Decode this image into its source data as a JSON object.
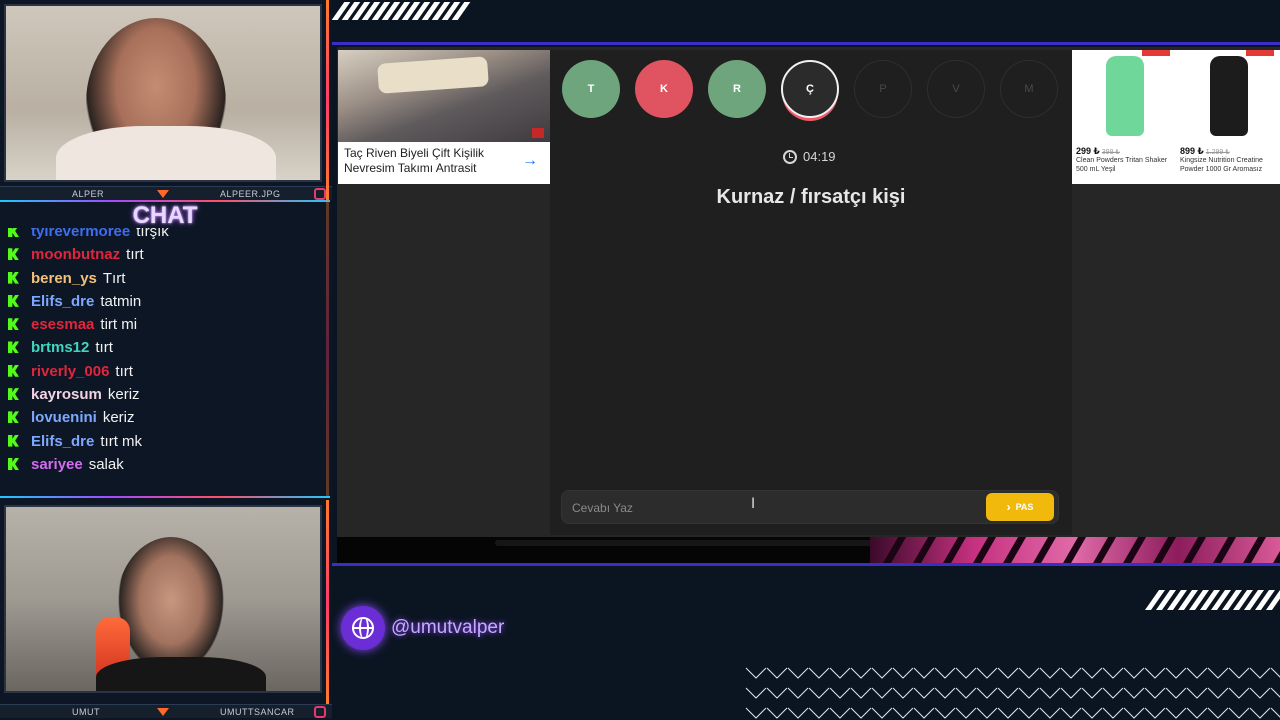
{
  "cams": {
    "top": {
      "left_name": "ALPER",
      "right_name": "ALPEER.JPG"
    },
    "bottom": {
      "left_name": "UMUT",
      "right_name": "UMUTTSANCAR"
    }
  },
  "chat": {
    "title": "CHAT",
    "messages": [
      {
        "user": "tyirevermoree",
        "text": "tırşık",
        "color": "#3f6df0"
      },
      {
        "user": "moonbutnaz",
        "text": "tırt",
        "color": "#e0263c"
      },
      {
        "user": "beren_ys",
        "text": "Tırt",
        "color": "#f2c27a"
      },
      {
        "user": "Elifs_dre",
        "text": "tatmin",
        "color": "#7ea8ff"
      },
      {
        "user": "esesmaa",
        "text": "tirt mi",
        "color": "#e0263c"
      },
      {
        "user": "brtms12",
        "text": "tırt",
        "color": "#3fd6c0"
      },
      {
        "user": "riverly_006",
        "text": "tırt",
        "color": "#e0263c"
      },
      {
        "user": "kayrosum",
        "text": "keriz",
        "color": "#f3d3e3"
      },
      {
        "user": "lovuenini",
        "text": "keriz",
        "color": "#7ea8ff"
      },
      {
        "user": "Elifs_dre",
        "text": "tırt mk",
        "color": "#7ea8ff"
      },
      {
        "user": "sariyee",
        "text": "salak",
        "color": "#d46cf2"
      }
    ]
  },
  "ads": {
    "left": {
      "caption": "Taç Riven Biyeli Çift Kişilik Nevresim Takımı Antrasit",
      "arrow": "→"
    },
    "right": [
      {
        "price": "299 ₺",
        "old_price": "399 ₺",
        "name": "Clean Powders Tritan Shaker 500 mL Yeşil",
        "bottle_color": "#6fd79a"
      },
      {
        "price": "899 ₺",
        "old_price": "1.299 ₺",
        "name": "Kingsize Nutrition Creatine Powder 1000 Gr Aromasız",
        "bottle_color": "#1c1c1c"
      }
    ]
  },
  "game": {
    "letters": [
      {
        "char": "T",
        "state": "correct",
        "color": "#6fa57d"
      },
      {
        "char": "K",
        "state": "wrong",
        "color": "#e05461"
      },
      {
        "char": "R",
        "state": "correct",
        "color": "#6fa57d"
      },
      {
        "char": "Ç",
        "state": "active",
        "color": "#2b2b2b"
      },
      {
        "char": "P",
        "state": "pending",
        "color": ""
      },
      {
        "char": "V",
        "state": "pending",
        "color": ""
      },
      {
        "char": "M",
        "state": "pending",
        "color": ""
      }
    ],
    "timer": "04:19",
    "clue": "Kurnaz / fırsatçı kişi",
    "answer_placeholder": "Cevabı Yaz",
    "pass_label": "PAS",
    "pass_icon": "›"
  },
  "social": {
    "handle": "@umutvalper",
    "icon": "globe-icon"
  },
  "colors": {
    "accent": "#3a2ec8",
    "pass": "#f0b90b",
    "kick": "#53fc18"
  }
}
